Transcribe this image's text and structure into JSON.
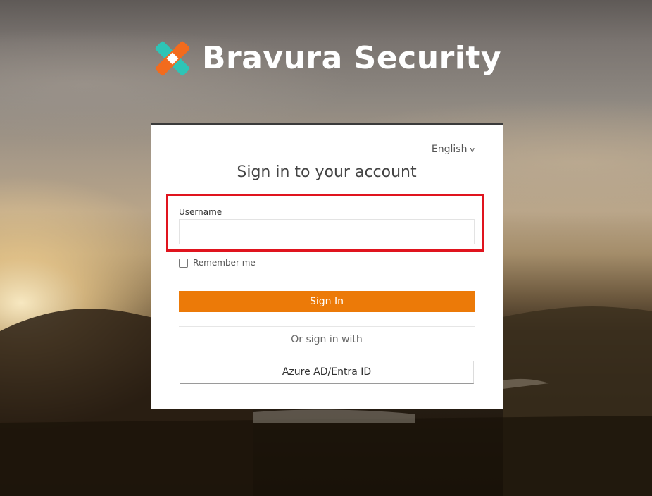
{
  "brand": {
    "name": "Bravura Security",
    "colors": {
      "teal": "#2ec4b6",
      "orange": "#f26b1d",
      "text": "#ffffff"
    }
  },
  "card": {
    "language": "English",
    "language_chevron": "v",
    "title": "Sign in to your account",
    "username_label": "Username",
    "username_value": "",
    "remember_label": "Remember me",
    "remember_checked": false,
    "signin_label": "Sign In",
    "or_text": "Or sign in with",
    "azure_label": "Azure AD/Entra ID"
  },
  "colors": {
    "accent": "#ec7a08",
    "highlight": "#e0141e"
  }
}
